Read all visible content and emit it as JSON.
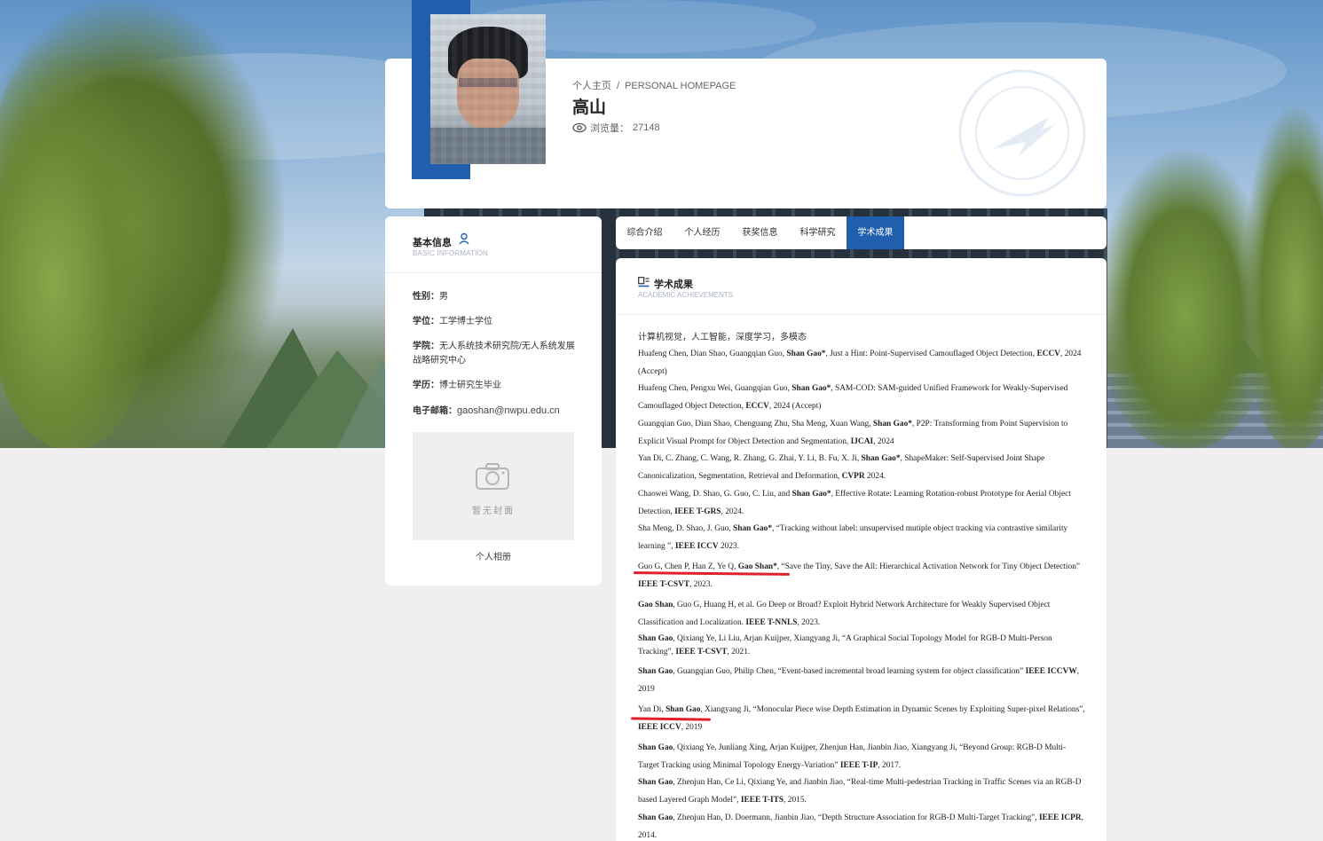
{
  "header": {
    "breadcrumb_cn": "个人主页",
    "breadcrumb_en": "PERSONAL HOMEPAGE",
    "name": "高山",
    "views_label": "浏览量：",
    "views_count": "27148"
  },
  "basic_info": {
    "title": "基本信息",
    "subtitle": "BASIC INFORMATION",
    "gender_label": "性别：",
    "gender": "男",
    "degree_label": "学位：",
    "degree": "工学博士学位",
    "college_label": "学院：",
    "college": "无人系统技术研究院/无人系统发展战略研究中心",
    "education_label": "学历：",
    "education": "博士研究生毕业",
    "email_label": "电子邮箱：",
    "email": "gaoshan@nwpu.edu.cn",
    "cover_placeholder": "暂无封面",
    "album_label": "个人相册"
  },
  "tabs": [
    {
      "label": "综合介绍"
    },
    {
      "label": "个人经历"
    },
    {
      "label": "获奖信息"
    },
    {
      "label": "科学研究"
    },
    {
      "label": "学术成果",
      "active": true
    }
  ],
  "achievements": {
    "title": "学术成果",
    "subtitle": "ACADEMIC ACHIEVEMENTS",
    "research_areas": "计算机视觉，人工智能，深度学习，多模态",
    "publications": [
      {
        "pre": "Huafeng Chen, Dian Shao, Guangqian Guo, ",
        "bold1": "Shan Gao*",
        "mid": ", Just a Hint: Point-Supervised Camouflaged Object Detection, ",
        "bold2": "ECCV",
        "post": ", 2024 (Accept)"
      },
      {
        "pre": "Huafeng Chen, Pengxu Wei, Guangqian Guo, ",
        "bold1": "Shan Gao*",
        "mid": ", SAM-COD: SAM-guided Unified Framework for Weakly-Supervised Camouflaged Object Detection, ",
        "bold2": "ECCV",
        "post": ", 2024 (Accept)"
      },
      {
        "pre": "Guangqian Guo, Dian Shao, Chenguang Zhu, Sha Meng, Xuan Wang, ",
        "bold1": "Shan Gao*",
        "mid": ", P2P: Transforming from Point Supervision to Explicit Visual Prompt for Object Detection and Segmentation, ",
        "bold2": "IJCAI",
        "post": ", 2024"
      },
      {
        "pre": "Yan Di, C. Zhang, C. Wang, R. Zhang, G. Zhai, Y. Li, B. Fu, X. Ji, ",
        "bold1": "Shan Gao*",
        "mid": ", ShapeMaker: Self-Supervised Joint Shape Canonicalization, Segmentation, Retrieval and Deformation, ",
        "bold2": "CVPR",
        "post": " 2024."
      },
      {
        "pre": "Chaowei Wang, D. Shao, G. Guo, C. Liu, and ",
        "bold1": "Shan Gao*",
        "mid": ", Effective Rotate: Learning Rotation-robust Prototype for Aerial Object Detection, ",
        "bold2": "IEEE T-GRS",
        "post": ", 2024."
      },
      {
        "pre": "Sha Meng, D. Shao, J. Guo,  ",
        "bold1": "Shan Gao*",
        "mid": ", “Tracking without label: unsupervised mutiple object tracking via contrastive similarity learning ”, ",
        "bold2": "IEEE ICCV",
        "post": " 2023."
      },
      {
        "pre": "Guo G, Chen P, Han Z, Ye Q, ",
        "bold1": "Gao Shan*",
        "mid": ", “Save the Tiny, Save the All: Hierarchical Activation Network for Tiny Object Detection” ",
        "bold2": "IEEE T-CSVT",
        "post": ", 2023."
      },
      {
        "pre": "",
        "bold1": "Gao Shan",
        "mid": ", Guo G, Huang H, et al. Go Deep or Broad? Exploit Hybrid Network Architecture for Weakly Supervised Object Classification and Localization. ",
        "bold2": "IEEE T-NNLS",
        "post": ", 2023."
      },
      {
        "pre": "",
        "bold1": "Shan Gao",
        "mid": ", Qixiang Ye, Li Liu, Arjan Kuijper, Xiangyang Ji, “A Graphical Social Topology Model for RGB-D Multi-Person Tracking”, ",
        "bold2": "IEEE T-CSVT",
        "post": ", 2021."
      },
      {
        "pre": "",
        "bold1": "Shan Gao",
        "mid": ", Guangqian Guo, Philip Chen, “Event-based incremental broad learning system for object classification” ",
        "bold2": "IEEE ICCVW",
        "post": ", 2019"
      },
      {
        "pre": "Yan Di, ",
        "bold1": "Shan Gao",
        "mid": ", Xiangyang Ji, “Monocular Piece wise Depth Estimation in Dynamic Scenes by Exploiting Super-pixel Relations”, ",
        "bold2": "IEEE ICCV",
        "post": ", 2019"
      },
      {
        "pre": "",
        "bold1": "Shan Gao",
        "mid": ", Qixiang Ye, Junliang Xing, Arjan Kuijper, Zhenjun Han, Jianbin Jiao, Xiangyang Ji, “Beyond Group: RGB-D Multi-Target Tracking using Minimal Topology Energy-Variation” ",
        "bold2": "IEEE T-IP",
        "post": ", 2017."
      },
      {
        "pre": "",
        "bold1": "Shan Gao",
        "mid": ", Zhenjun Han, Ce Li, Qixiang Ye, and Jianbin Jiao, “Real-time Multi-pedestrian Tracking in Traffic Scenes via an RGB-D based Layered Graph Model”, ",
        "bold2": "IEEE T-ITS",
        "post": ", 2015."
      },
      {
        "pre": "",
        "bold1": "Shan Gao",
        "mid": ", Zhenjun Han, D. Doermann, Jianbin Jiao, “Depth Structure Association for RGB-D Multi-Target Tracking”, ",
        "bold2": "IEEE ICPR",
        "post": ", 2014."
      }
    ]
  },
  "colors": {
    "accent": "#1f5fae",
    "underline": "#e0202a"
  }
}
